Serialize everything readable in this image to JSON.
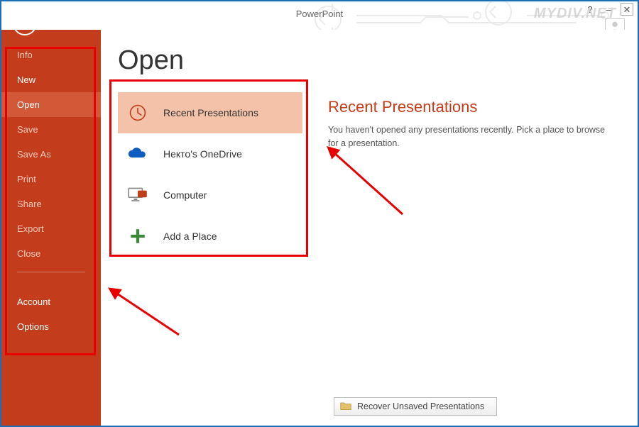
{
  "title": "PowerPoint",
  "watermark": "MYDIV.NET",
  "sidebar": {
    "items": [
      {
        "label": "Info",
        "enabled": false,
        "selected": false
      },
      {
        "label": "New",
        "enabled": true,
        "selected": false
      },
      {
        "label": "Open",
        "enabled": true,
        "selected": true
      },
      {
        "label": "Save",
        "enabled": false,
        "selected": false
      },
      {
        "label": "Save As",
        "enabled": false,
        "selected": false
      },
      {
        "label": "Print",
        "enabled": false,
        "selected": false
      },
      {
        "label": "Share",
        "enabled": false,
        "selected": false
      },
      {
        "label": "Export",
        "enabled": false,
        "selected": false
      },
      {
        "label": "Close",
        "enabled": false,
        "selected": false
      }
    ],
    "footer": [
      {
        "label": "Account"
      },
      {
        "label": "Options"
      }
    ]
  },
  "page": {
    "heading": "Open",
    "places": [
      {
        "icon": "clock-icon",
        "label": "Recent Presentations",
        "selected": true
      },
      {
        "icon": "onedrive-icon",
        "label": "Некто's OneDrive",
        "selected": false
      },
      {
        "icon": "computer-icon",
        "label": "Computer",
        "selected": false
      },
      {
        "icon": "add-place-icon",
        "label": "Add a Place",
        "selected": false
      }
    ],
    "detail_heading": "Recent Presentations",
    "detail_message": "You haven't opened any presentations recently. Pick a place to browse for a presentation."
  },
  "recover_label": "Recover Unsaved Presentations"
}
